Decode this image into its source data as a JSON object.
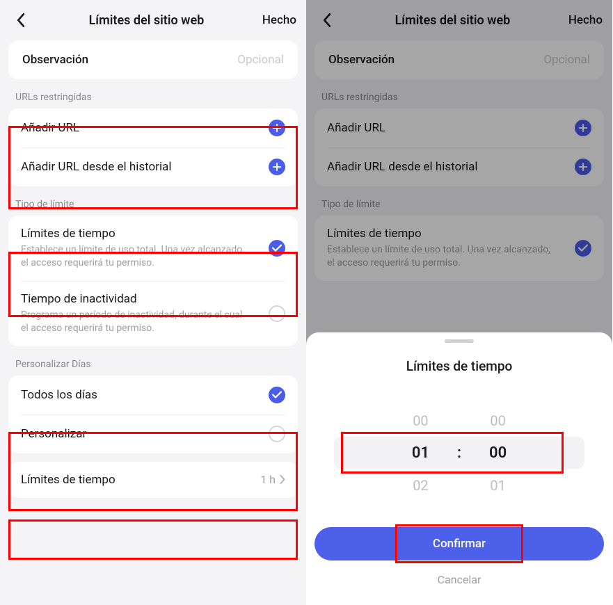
{
  "header": {
    "title": "Límites del sitio web",
    "done": "Hecho"
  },
  "observation": {
    "label": "Observación",
    "placeholder": "Opcional"
  },
  "sections": {
    "urls_label": "URLs restringidas",
    "type_label": "Tipo de límite",
    "days_label": "Personalizar Días"
  },
  "urls": {
    "add": "Añadir URL",
    "add_history": "Añadir URL desde el historial"
  },
  "limit_types": {
    "time": {
      "title": "Límites de tiempo",
      "desc": "Establece un límite de uso total. Una vez alcanzado, el acceso requerirá tu permiso."
    },
    "downtime": {
      "title": "Tiempo de inactividad",
      "desc": "Programa un período de inactividad, durante el cual el acceso requerirá tu permiso."
    }
  },
  "days": {
    "every": "Todos los días",
    "custom": "Personalizar"
  },
  "limit_row": {
    "label": "Límites de tiempo",
    "value": "1 h"
  },
  "sheet": {
    "title": "Límites de tiempo",
    "hours_prev": "00",
    "hours_sel": "01",
    "hours_next": "02",
    "mins_prev": "00",
    "mins_sel": "00",
    "mins_next": "01",
    "confirm": "Confirmar",
    "cancel": "Cancelar"
  }
}
